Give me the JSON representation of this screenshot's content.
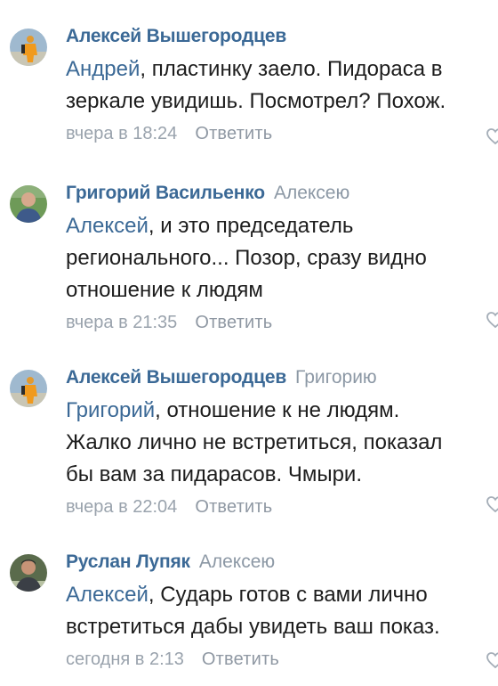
{
  "comments": [
    {
      "author": "Алексей Вышегородцев",
      "reply_to": "",
      "mention": "Андрей",
      "lines": [
        ", пластинку заело. Пидораса в",
        "зеркале увидишь. Посмотрел? Похож."
      ],
      "time": "вчера в 18:24",
      "reply_label": "Ответить",
      "avatar_icon": "avatar-orange-figure"
    },
    {
      "author": "Григорий Васильенко",
      "reply_to": "Алексею",
      "mention": "Алексей",
      "lines": [
        ", и это председатель",
        "регионального... Позор, сразу видно",
        "отношение к людям"
      ],
      "time": "вчера в 21:35",
      "reply_label": "Ответить",
      "avatar_icon": "avatar-man-portrait"
    },
    {
      "author": "Алексей Вышегородцев",
      "reply_to": "Григорию",
      "mention": "Григорий",
      "lines": [
        ", отношение к не людям.",
        "Жалко лично не встретиться, показал",
        "бы вам за пидарасов. Чмыри."
      ],
      "time": "вчера в 22:04",
      "reply_label": "Ответить",
      "avatar_icon": "avatar-orange-figure"
    },
    {
      "author": "Руслан Лупяк",
      "reply_to": "Алексею",
      "mention": "Алексей",
      "lines": [
        ", Сударь готов с вами лично",
        "встретиться дабы увидеть ваш показ."
      ],
      "time": "сегодня в 2:13",
      "reply_label": "Ответить",
      "avatar_icon": "avatar-man-portrait-dark"
    }
  ],
  "colors": {
    "link": "#3b6996",
    "meta": "#9aa3ad",
    "text": "#1d1d1d"
  }
}
